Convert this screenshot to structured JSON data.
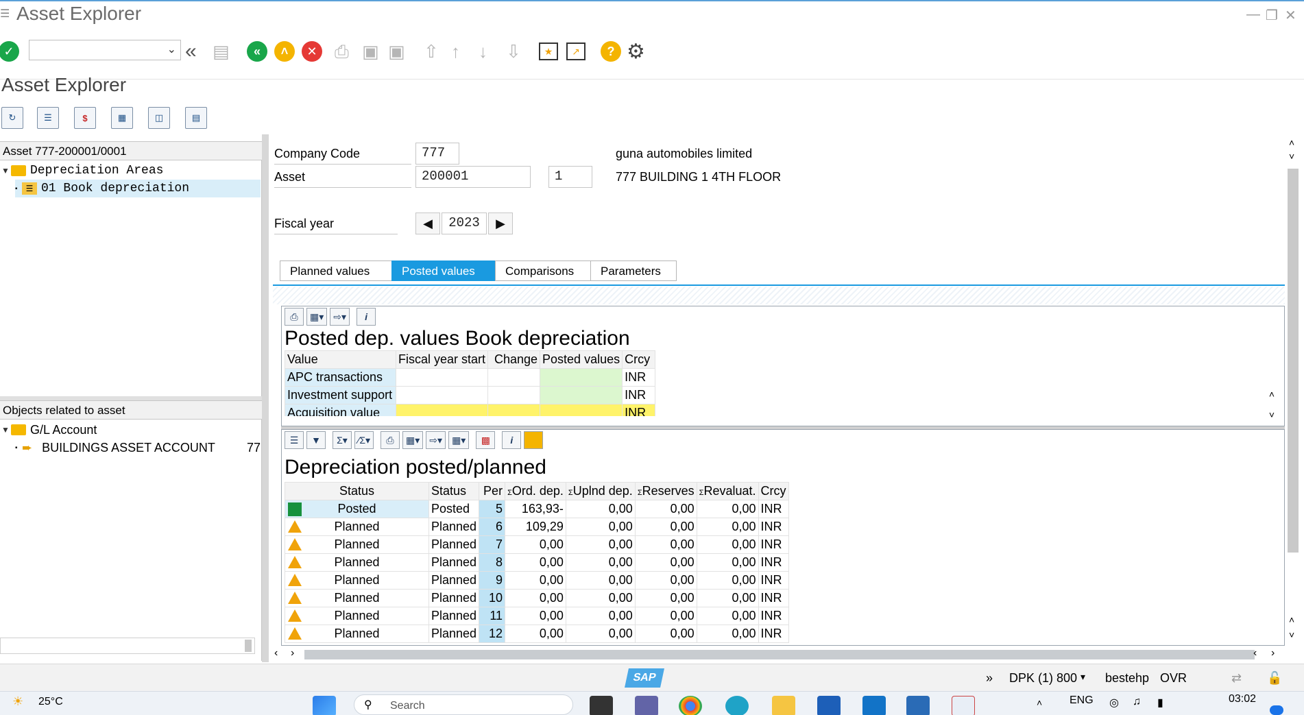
{
  "window": {
    "title": "Asset Explorer"
  },
  "toolbar": {
    "command_field_value": "",
    "icons": [
      "enter-icon",
      "back-double-icon",
      "save-icon",
      "back-icon",
      "exit-icon",
      "cancel-icon",
      "print-icon",
      "find-icon",
      "find-next-icon",
      "first-page-icon",
      "previous-page-icon",
      "next-page-icon",
      "last-page-icon",
      "create-session-icon",
      "create-shortcut-icon",
      "help-icon",
      "settings-icon"
    ]
  },
  "page": {
    "title": "Asset Explorer"
  },
  "left_top": {
    "header": "Asset 777-200001/0001",
    "tree": [
      {
        "label": "Depreciation Areas",
        "icon": "folder-icon"
      },
      {
        "label": "01 Book depreciation",
        "icon": "list-icon"
      }
    ]
  },
  "left_bottom": {
    "header": "Objects related to asset",
    "tree": [
      {
        "label": "G/L Account",
        "icon": "folder-icon"
      },
      {
        "label": "BUILDINGS ASSET ACCOUNT",
        "value": "77",
        "icon": "account-icon"
      }
    ]
  },
  "header_fields": {
    "company_code_label": "Company Code",
    "company_code": "777",
    "company_name": "guna automobiles limited",
    "asset_label": "Asset",
    "asset": "200001",
    "subnumber": "1",
    "asset_description": "777 BUILDING 1 4TH FLOOR",
    "fiscal_year_label": "Fiscal year",
    "fiscal_year": "2023"
  },
  "tabs": [
    {
      "label": "Planned values",
      "active": false
    },
    {
      "label": "Posted values",
      "active": true
    },
    {
      "label": "Comparisons",
      "active": false
    },
    {
      "label": "Parameters",
      "active": false
    }
  ],
  "posted_grid": {
    "title": "Posted dep. values Book depreciation",
    "columns": [
      "Value",
      "Fiscal year start",
      "Change",
      "Posted values",
      "Crcy"
    ],
    "rows": [
      {
        "value": "APC transactions",
        "fy_start": "",
        "change": "",
        "posted": "",
        "crcy": "INR"
      },
      {
        "value": "Investment support",
        "fy_start": "",
        "change": "",
        "posted": "",
        "crcy": "INR"
      },
      {
        "value": "Acquisition value",
        "fy_start": "",
        "change": "",
        "posted": "",
        "crcy": "INR"
      }
    ]
  },
  "dep_grid": {
    "title": "Depreciation posted/planned",
    "columns": [
      "Status",
      "Status",
      "Per",
      "Ord. dep.",
      "Uplnd dep.",
      "Reserves",
      "Revaluat.",
      "Crcy"
    ],
    "rows": [
      {
        "icon": "posted-icon",
        "status": "Posted",
        "status2": "Posted",
        "per": "5",
        "ord": "163,93-",
        "uplnd": "0,00",
        "reserves": "0,00",
        "reval": "0,00",
        "crcy": "INR"
      },
      {
        "icon": "warning-icon",
        "status": "Planned",
        "status2": "Planned",
        "per": "6",
        "ord": "109,29",
        "uplnd": "0,00",
        "reserves": "0,00",
        "reval": "0,00",
        "crcy": "INR"
      },
      {
        "icon": "warning-icon",
        "status": "Planned",
        "status2": "Planned",
        "per": "7",
        "ord": "0,00",
        "uplnd": "0,00",
        "reserves": "0,00",
        "reval": "0,00",
        "crcy": "INR"
      },
      {
        "icon": "warning-icon",
        "status": "Planned",
        "status2": "Planned",
        "per": "8",
        "ord": "0,00",
        "uplnd": "0,00",
        "reserves": "0,00",
        "reval": "0,00",
        "crcy": "INR"
      },
      {
        "icon": "warning-icon",
        "status": "Planned",
        "status2": "Planned",
        "per": "9",
        "ord": "0,00",
        "uplnd": "0,00",
        "reserves": "0,00",
        "reval": "0,00",
        "crcy": "INR"
      },
      {
        "icon": "warning-icon",
        "status": "Planned",
        "status2": "Planned",
        "per": "10",
        "ord": "0,00",
        "uplnd": "0,00",
        "reserves": "0,00",
        "reval": "0,00",
        "crcy": "INR"
      },
      {
        "icon": "warning-icon",
        "status": "Planned",
        "status2": "Planned",
        "per": "11",
        "ord": "0,00",
        "uplnd": "0,00",
        "reserves": "0,00",
        "reval": "0,00",
        "crcy": "INR"
      },
      {
        "icon": "warning-icon",
        "status": "Planned",
        "status2": "Planned",
        "per": "12",
        "ord": "0,00",
        "uplnd": "0,00",
        "reserves": "0,00",
        "reval": "0,00",
        "crcy": "INR"
      }
    ]
  },
  "statusbar": {
    "logo": "SAP",
    "system": "DPK (1) 800",
    "server": "bestehp",
    "mode": "OVR"
  },
  "taskbar": {
    "weather": "25°C",
    "search_placeholder": "Search",
    "language": "ENG",
    "time": "03:02"
  },
  "colors": {
    "accent": "#1a9ae0",
    "posted_green": "#17913d",
    "warning": "#f0a30a",
    "row_header": "#d9eef9",
    "posted_cell": "#dcf7cf",
    "highlight_yellow": "#fff36a"
  }
}
